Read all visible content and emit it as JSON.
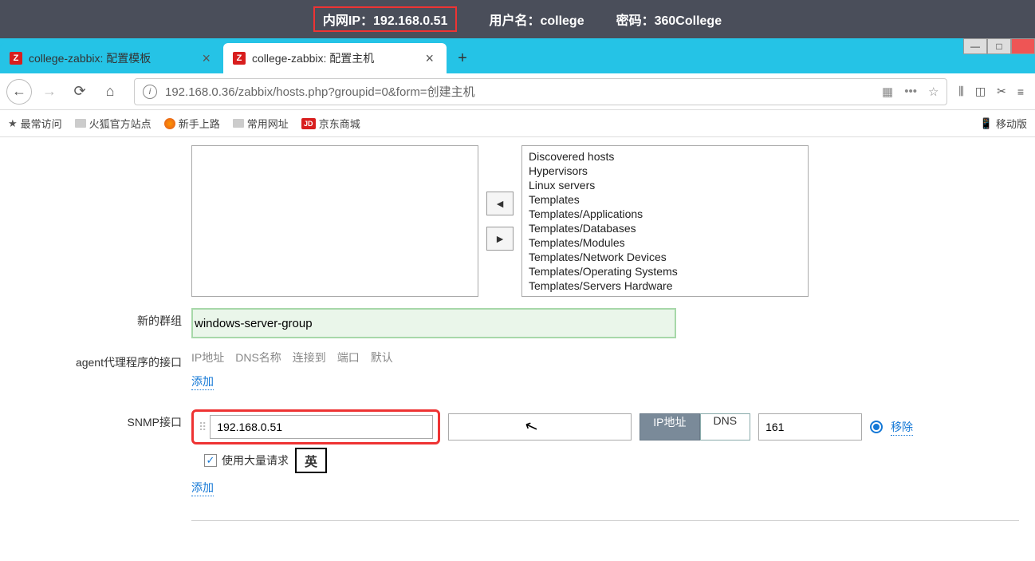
{
  "banner": {
    "ip_label": "内网IP：",
    "ip": "192.168.0.51",
    "user_label": "用户名：",
    "user": "college",
    "pwd_label": "密码：",
    "pwd": "360College"
  },
  "tabs": [
    {
      "title": "college-zabbix: 配置模板"
    },
    {
      "title": "college-zabbix: 配置主机"
    }
  ],
  "new_tab": "+",
  "url": "192.168.0.36/zabbix/hosts.php?groupid=0&form=创建主机",
  "menu_dots": "•••",
  "bookmarks": {
    "freq": "最常访问",
    "ff_site": "火狐官方站点",
    "newbie": "新手上路",
    "common": "常用网址",
    "jd": "京东商城",
    "mobile": "移动版"
  },
  "labels": {
    "new_group": "新的群组",
    "agent_iface": "agent代理程序的接口",
    "snmp_iface": "SNMP接口"
  },
  "groups_right": [
    "Discovered hosts",
    "Hypervisors",
    "Linux servers",
    "Templates",
    "Templates/Applications",
    "Templates/Databases",
    "Templates/Modules",
    "Templates/Network Devices",
    "Templates/Operating Systems",
    "Templates/Servers Hardware"
  ],
  "new_group_value": "windows-server-group",
  "iface_headers": {
    "ip": "IP地址",
    "dns": "DNS名称",
    "connect": "连接到",
    "port": "端口",
    "default": "默认"
  },
  "add": "添加",
  "snmp": {
    "ip": "192.168.0.51",
    "dns": "",
    "btn_ip": "IP地址",
    "btn_dns": "DNS",
    "port": "161",
    "remove": "移除",
    "bulk": "使用大量请求"
  },
  "ime": "英",
  "arrows": {
    "left": "◄",
    "right": "►"
  }
}
